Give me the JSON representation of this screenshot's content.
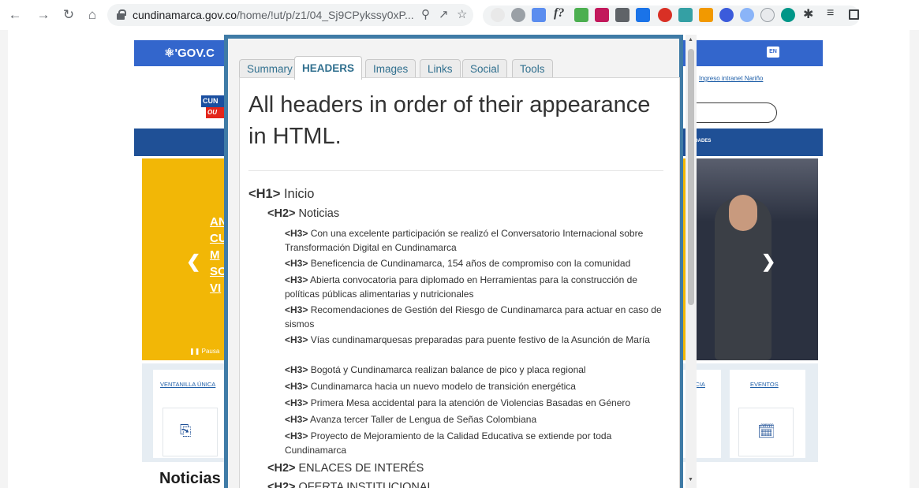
{
  "browser": {
    "url_host": "cundinamarca.gov.co",
    "url_path": "/home/!ut/p/z1/04_Sj9CPykssy0xP..."
  },
  "page": {
    "gov_brand": "GOV.C",
    "en_label": "EN",
    "intranet_link": "Ingreso intranet Nariño",
    "logo_top": "CUN",
    "logo_bottom": "OU",
    "nav_partial": "TIDADES",
    "hero_links": [
      "AN",
      "CU",
      "M",
      "SO",
      "VI"
    ],
    "pause_label": "Pausa",
    "cards": [
      {
        "label": "VENTANILLA ÚNICA"
      },
      {
        "label": "NCIA"
      },
      {
        "label": "EVENTOS"
      }
    ],
    "noticias_heading": "Noticias"
  },
  "panel": {
    "tabs": [
      "Summary",
      "HEADERS",
      "Images",
      "Links",
      "Social",
      "Tools"
    ],
    "active_tab": "HEADERS",
    "title": "All headers in order of their appearance in HTML.",
    "headers": [
      {
        "level": "H1",
        "tag": "<H1>",
        "text": "Inicio"
      },
      {
        "level": "H2",
        "tag": "<H2>",
        "text": "Noticias"
      },
      {
        "level": "H3",
        "tag": "<H3>",
        "text": "Con una excelente participación se realizó el Conversatorio Internacional sobre Transformación Digital en Cundinamarca"
      },
      {
        "level": "H3",
        "tag": "<H3>",
        "text": "Beneficencia de Cundinamarca, 154 años de compromiso con la comunidad"
      },
      {
        "level": "H3",
        "tag": "<H3>",
        "text": "Abierta convocatoria para diplomado en Herramientas para la construcción de políticas públicas alimentarias y nutricionales"
      },
      {
        "level": "H3",
        "tag": "<H3>",
        "text": "Recomendaciones de Gestión del Riesgo de Cundinamarca para actuar en caso de sismos"
      },
      {
        "level": "H3",
        "tag": "<H3>",
        "text": "Vías cundinamarquesas preparadas para puente festivo de la Asunción de María"
      },
      {
        "level": "H3",
        "tag": "<H3>",
        "text": "Bogotá y Cundinamarca realizan balance de pico y placa regional"
      },
      {
        "level": "H3",
        "tag": "<H3>",
        "text": "Cundinamarca hacia un nuevo modelo de transición energética"
      },
      {
        "level": "H3",
        "tag": "<H3>",
        "text": "Primera Mesa accidental para la atención de Violencias Basadas en Género"
      },
      {
        "level": "H3",
        "tag": "<H3>",
        "text": "Avanza tercer Taller de Lengua de Señas Colombiana"
      },
      {
        "level": "H3",
        "tag": "<H3>",
        "text": "Proyecto de Mejoramiento de la Calidad Educativa se extiende por toda Cundinamarca"
      },
      {
        "level": "H2",
        "tag": "<H2>",
        "text": "ENLACES DE INTERÉS"
      },
      {
        "level": "H2",
        "tag": "<H2>",
        "text": "OFERTA INSTITUCIONAL"
      }
    ]
  },
  "icons": [
    "back-icon",
    "forward-icon",
    "reload-icon",
    "home-icon",
    "lock-icon",
    "zoom-icon",
    "share-icon",
    "star-icon",
    "extensions-icon",
    "media-icon",
    "side-panel-icon"
  ],
  "colors": {
    "panel_border": "#3f7ba6",
    "gov_bar": "#3366cc",
    "hero_yellow": "#f2b706",
    "nav_blue": "#1f5096"
  }
}
